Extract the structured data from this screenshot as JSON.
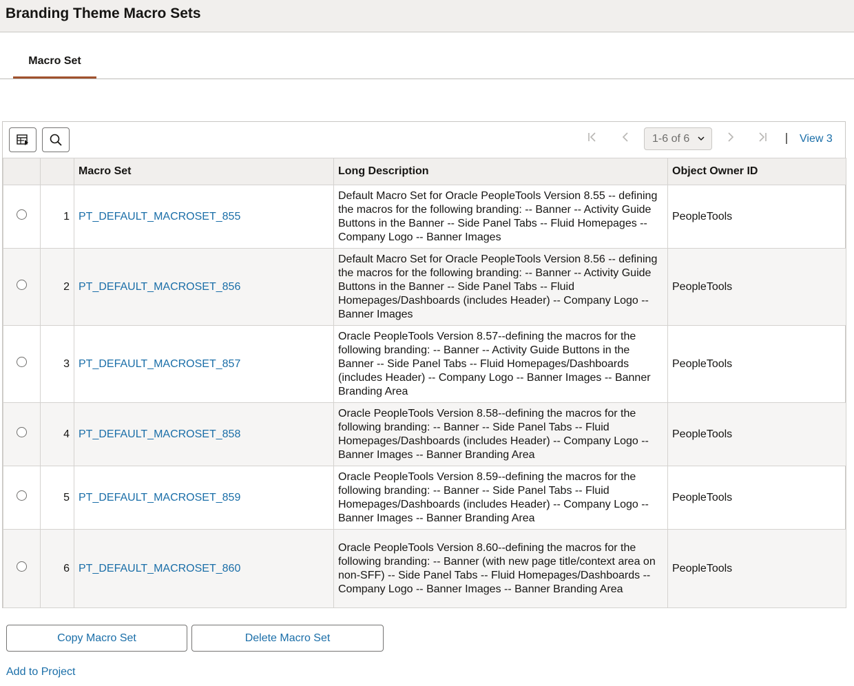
{
  "page": {
    "title": "Branding Theme Macro Sets"
  },
  "tabs": [
    {
      "label": "Macro Set"
    }
  ],
  "toolbar": {
    "personalize_icon": "grid-personalize-icon",
    "search_icon": "search-icon",
    "pager_value": "1-6 of 6",
    "view_all": "View 3"
  },
  "table": {
    "headers": [
      "",
      "",
      "Macro Set",
      "Long Description",
      "Object Owner ID"
    ],
    "rows": [
      {
        "num": "1",
        "macro_set": "PT_DEFAULT_MACROSET_855",
        "description": "Default Macro Set for Oracle PeopleTools Version 8.55 -- defining the macros for the following branding: -- Banner -- Activity Guide Buttons in the Banner -- Side Panel Tabs -- Fluid Homepages -- Company Logo -- Banner Images",
        "owner": "PeopleTools"
      },
      {
        "num": "2",
        "macro_set": "PT_DEFAULT_MACROSET_856",
        "description": "Default Macro Set for Oracle PeopleTools Version 8.56 -- defining the macros for the following branding: -- Banner -- Activity Guide Buttons in the Banner -- Side Panel Tabs -- Fluid Homepages/Dashboards (includes Header) -- Company Logo -- Banner Images",
        "owner": "PeopleTools"
      },
      {
        "num": "3",
        "macro_set": "PT_DEFAULT_MACROSET_857",
        "description": "Oracle PeopleTools Version 8.57--defining the macros for the following branding: -- Banner -- Activity Guide Buttons in the Banner -- Side Panel Tabs -- Fluid Homepages/Dashboards (includes Header) -- Company Logo -- Banner Images -- Banner Branding Area",
        "owner": "PeopleTools"
      },
      {
        "num": "4",
        "macro_set": "PT_DEFAULT_MACROSET_858",
        "description": "Oracle PeopleTools Version 8.58--defining the macros for the following branding: -- Banner -- Side Panel Tabs -- Fluid Homepages/Dashboards (includes Header) -- Company Logo -- Banner Images -- Banner Branding Area",
        "owner": "PeopleTools"
      },
      {
        "num": "5",
        "macro_set": "PT_DEFAULT_MACROSET_859",
        "description": "Oracle PeopleTools Version 8.59--defining the macros for the following branding: -- Banner -- Side Panel Tabs -- Fluid Homepages/Dashboards (includes Header) -- Company Logo -- Banner Images -- Banner Branding Area",
        "owner": "PeopleTools"
      },
      {
        "num": "6",
        "macro_set": "PT_DEFAULT_MACROSET_860",
        "description": "Oracle PeopleTools Version 8.60--defining the macros for the following branding: -- Banner (with new page title/context area on non-SFF) -- Side Panel Tabs -- Fluid Homepages/Dashboards -- Company Logo -- Banner Images -- Banner Branding Area",
        "owner": "PeopleTools"
      }
    ]
  },
  "actions": {
    "copy": "Copy Macro Set",
    "delete": "Delete Macro Set",
    "add_to_project": "Add to Project"
  },
  "colors": {
    "link": "#1a6ea8",
    "tab_underline": "#a0522d",
    "header_bg": "#f1efed"
  }
}
